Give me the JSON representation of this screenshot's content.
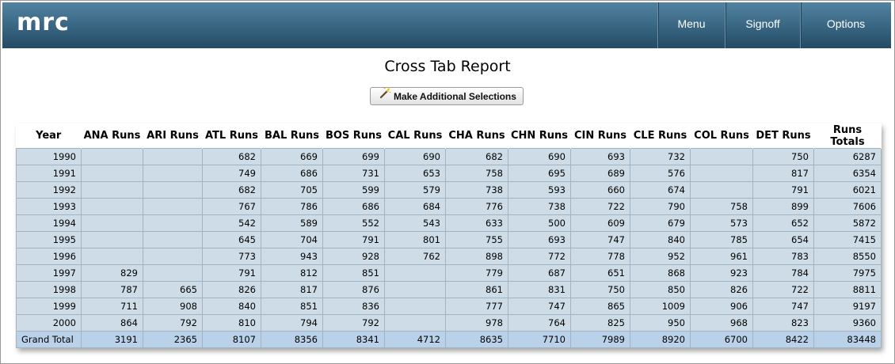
{
  "header": {
    "logo": "mrc",
    "nav": {
      "menu": "Menu",
      "signoff": "Signoff",
      "options": "Options"
    }
  },
  "report": {
    "title": "Cross Tab Report",
    "selection_button": "Make Additional Selections"
  },
  "table": {
    "columns": [
      "Year",
      "ANA Runs",
      "ARI Runs",
      "ATL Runs",
      "BAL Runs",
      "BOS Runs",
      "CAL Runs",
      "CHA Runs",
      "CHN Runs",
      "CIN Runs",
      "CLE Runs",
      "COL Runs",
      "DET Runs",
      "Runs Totals"
    ],
    "rows": [
      [
        "1990",
        "",
        "",
        "682",
        "669",
        "699",
        "690",
        "682",
        "690",
        "693",
        "732",
        "",
        "750",
        "6287"
      ],
      [
        "1991",
        "",
        "",
        "749",
        "686",
        "731",
        "653",
        "758",
        "695",
        "689",
        "576",
        "",
        "817",
        "6354"
      ],
      [
        "1992",
        "",
        "",
        "682",
        "705",
        "599",
        "579",
        "738",
        "593",
        "660",
        "674",
        "",
        "791",
        "6021"
      ],
      [
        "1993",
        "",
        "",
        "767",
        "786",
        "686",
        "684",
        "776",
        "738",
        "722",
        "790",
        "758",
        "899",
        "7606"
      ],
      [
        "1994",
        "",
        "",
        "542",
        "589",
        "552",
        "543",
        "633",
        "500",
        "609",
        "679",
        "573",
        "652",
        "5872"
      ],
      [
        "1995",
        "",
        "",
        "645",
        "704",
        "791",
        "801",
        "755",
        "693",
        "747",
        "840",
        "785",
        "654",
        "7415"
      ],
      [
        "1996",
        "",
        "",
        "773",
        "943",
        "928",
        "762",
        "898",
        "772",
        "778",
        "952",
        "961",
        "783",
        "8550"
      ],
      [
        "1997",
        "829",
        "",
        "791",
        "812",
        "851",
        "",
        "779",
        "687",
        "651",
        "868",
        "923",
        "784",
        "7975"
      ],
      [
        "1998",
        "787",
        "665",
        "826",
        "817",
        "876",
        "",
        "861",
        "831",
        "750",
        "850",
        "826",
        "722",
        "8811"
      ],
      [
        "1999",
        "711",
        "908",
        "840",
        "851",
        "836",
        "",
        "777",
        "747",
        "865",
        "1009",
        "906",
        "747",
        "9197"
      ],
      [
        "2000",
        "864",
        "792",
        "810",
        "794",
        "792",
        "",
        "978",
        "764",
        "825",
        "950",
        "968",
        "823",
        "9360"
      ]
    ],
    "total": [
      "Grand Total",
      "3191",
      "2365",
      "8107",
      "8356",
      "8341",
      "4712",
      "8635",
      "7710",
      "7989",
      "8920",
      "6700",
      "8422",
      "83448"
    ]
  },
  "colors": {
    "header_top": "#5283a1",
    "header_bottom": "#234b64",
    "cell_bg": "#cddce6",
    "total_bg": "#bad1ea"
  }
}
